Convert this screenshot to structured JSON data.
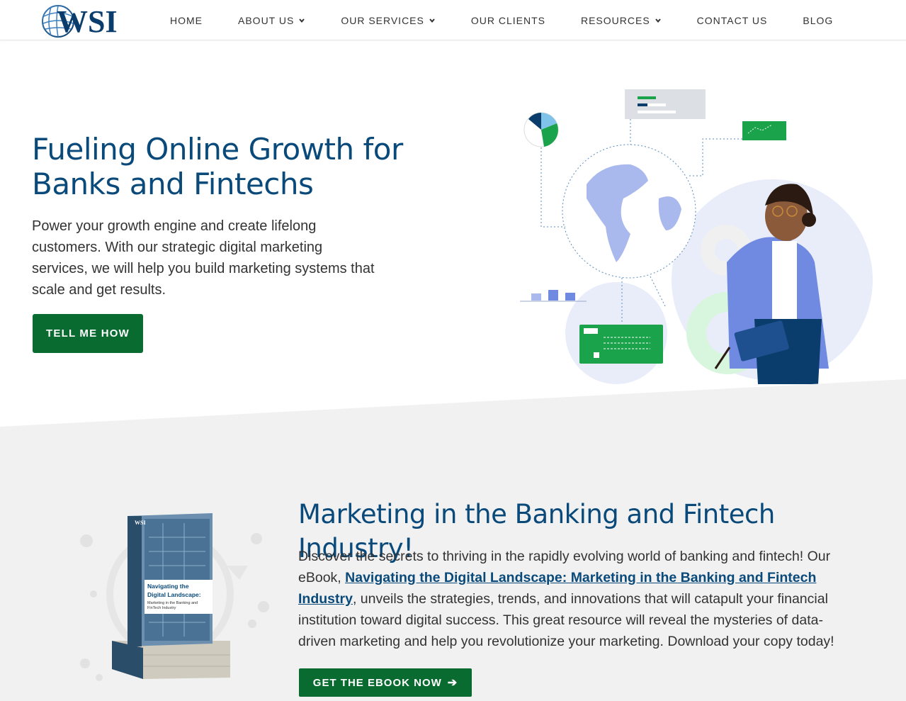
{
  "header": {
    "logo_text": "WSI",
    "nav": [
      {
        "label": "HOME",
        "has_dropdown": false
      },
      {
        "label": "ABOUT US",
        "has_dropdown": true
      },
      {
        "label": "OUR SERVICES",
        "has_dropdown": true
      },
      {
        "label": "OUR CLIENTS",
        "has_dropdown": false
      },
      {
        "label": "RESOURCES",
        "has_dropdown": true
      },
      {
        "label": "CONTACT US",
        "has_dropdown": false
      },
      {
        "label": "BLOG",
        "has_dropdown": false
      }
    ]
  },
  "hero": {
    "title": "Fueling Online Growth for Banks and Fintechs",
    "text": "Power your growth engine and create lifelong customers. With our strategic digital marketing services, we will help you build marketing systems that scale and get results.",
    "button_label": "TELL ME HOW"
  },
  "ebook": {
    "title": "Marketing in the Banking and Fintech Industry!",
    "text_before": "Discover the secrets to thriving in the rapidly evolving world of banking and fintech! Our eBook, ",
    "link_text": "Navigating the Digital Landscape: Marketing in the Banking and Fintech Industry",
    "text_after": ", unveils the strategies, trends, and innovations that will catapult your financial institution toward digital success. This great resource will reveal the mysteries of data-driven marketing and help you revolutionize your marketing. Download your copy today!",
    "button_label": "GET THE EBOOK NOW",
    "book_cover_title": "Navigating the Digital Landscape:",
    "book_cover_subtitle": "Marketing in the Banking and FinTech Industry",
    "book_logo": "WSI"
  },
  "colors": {
    "brand_blue": "#0a4a7a",
    "brand_green": "#096b2f",
    "section_grey": "#f1f1f1"
  }
}
